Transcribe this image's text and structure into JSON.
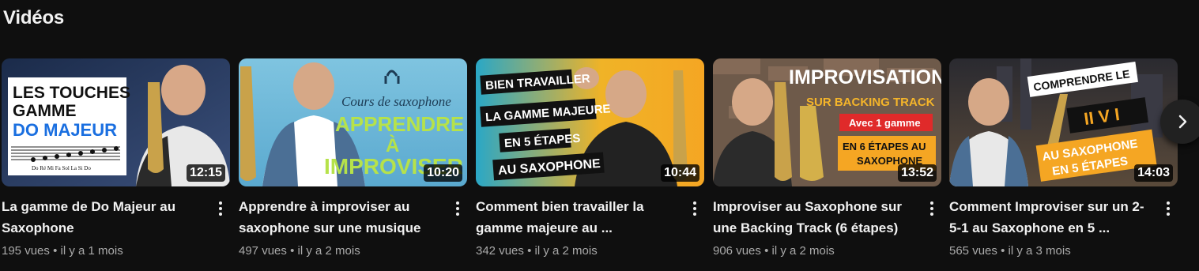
{
  "shelf": {
    "title": "Vidéos"
  },
  "videos": [
    {
      "title": "La gamme de Do Majeur au Saxophone",
      "views": "195 vues",
      "age": "il y a 1 mois",
      "duration": "12:15",
      "thumb_text": [
        "LES TOUCHES",
        "GAMME",
        "DO MAJEUR",
        "Do Ré Mi Fa   Sol La Si Do"
      ]
    },
    {
      "title": "Apprendre à improviser au saxophone sur une musique",
      "views": "497 vues",
      "age": "il y a 2 mois",
      "duration": "10:20",
      "thumb_text": [
        "Cours de saxophone",
        "APPRENDRE",
        "À",
        "IMPROVISER"
      ]
    },
    {
      "title": "Comment bien travailler la gamme majeure au ...",
      "views": "342 vues",
      "age": "il y a 2 mois",
      "duration": "10:44",
      "thumb_text": [
        "BIEN TRAVAILLER",
        "LA GAMME MAJEURE",
        "EN 5 ÉTAPES",
        "AU SAXOPHONE"
      ]
    },
    {
      "title": "Improviser au Saxophone sur une Backing Track (6 étapes)",
      "views": "906 vues",
      "age": "il y a 2 mois",
      "duration": "13:52",
      "thumb_text": [
        "IMPROVISATION",
        "SUR BACKING TRACK",
        "Avec 1 gamme",
        "EN 6 ÉTAPES AU",
        "SAXOPHONE"
      ]
    },
    {
      "title": "Comment Improviser sur un 2-5-1 au Saxophone en 5 ...",
      "views": "565 vues",
      "age": "il y a 3 mois",
      "duration": "14:03",
      "thumb_text": [
        "COMPRENDRE LE",
        "II V I",
        "AU SAXOPHONE",
        "EN 5 ÉTAPES"
      ]
    }
  ],
  "stats_separator": "•",
  "icons": {
    "menu": "more-vert-icon",
    "next": "chevron-right-icon"
  },
  "colors": {
    "background": "#0f0f0f",
    "text_primary": "#f1f1f1",
    "text_secondary": "#aaaaaa"
  }
}
